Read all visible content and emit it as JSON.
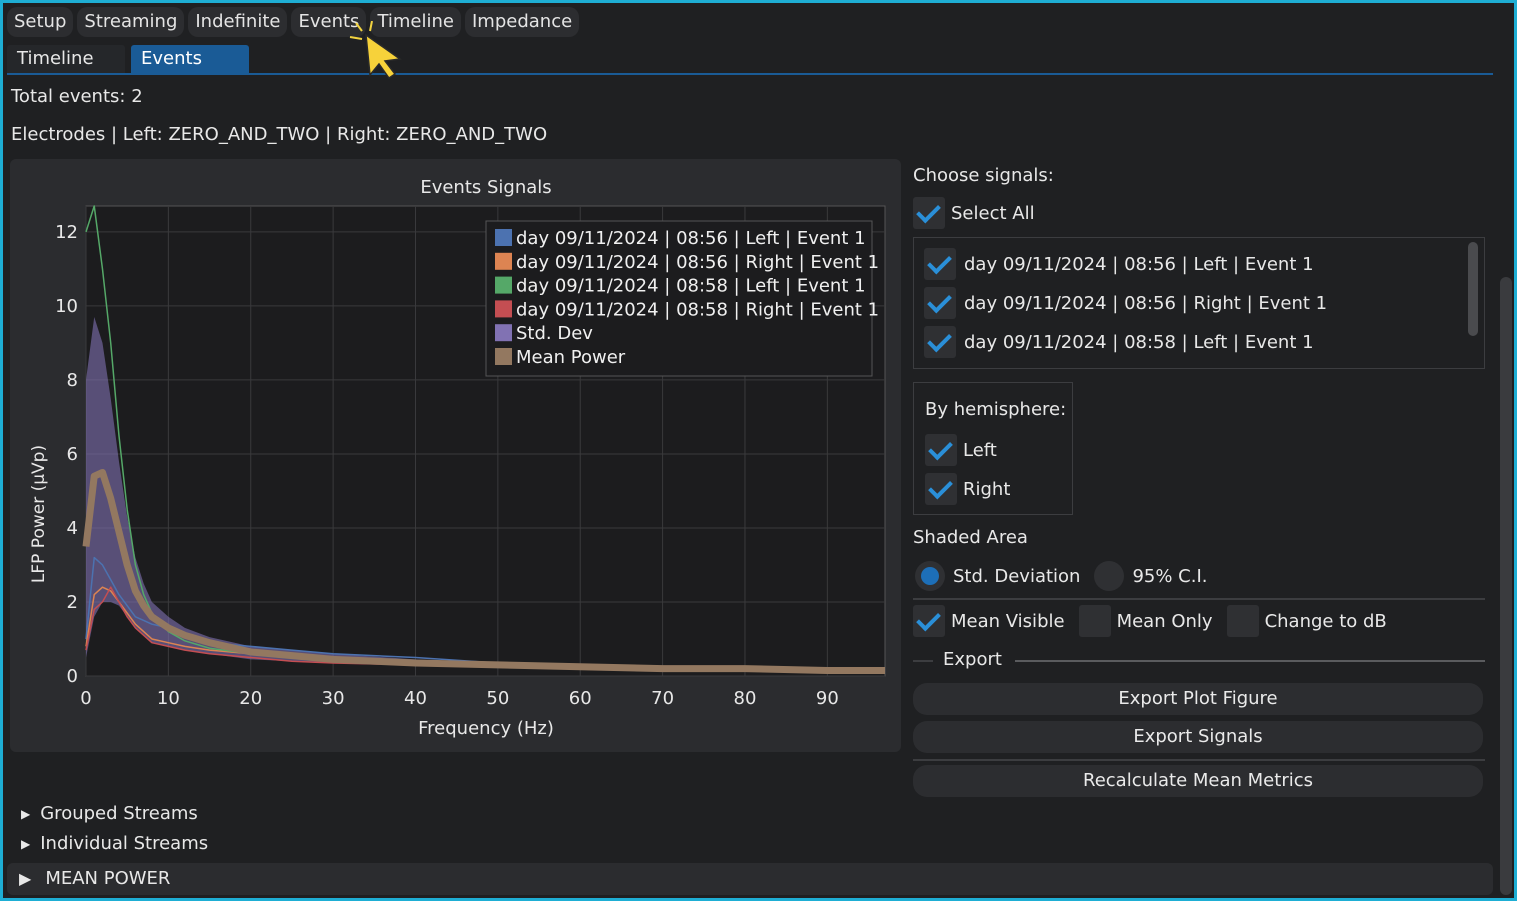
{
  "top_tabs": [
    "Setup",
    "Streaming",
    "Indefinite",
    "Events",
    "Timeline",
    "Impedance"
  ],
  "sub_tabs": [
    "Timeline",
    "Events"
  ],
  "active_sub_tab": "Events",
  "info": {
    "total_events": "Total events: 2",
    "electrodes": "Electrodes | Left: ZERO_AND_TWO | Right: ZERO_AND_TWO"
  },
  "chart_data": {
    "type": "line",
    "title": "Events Signals",
    "xlabel": "Frequency (Hz)",
    "ylabel": "LFP Power (µVp)",
    "xlim": [
      0,
      97
    ],
    "ylim": [
      0,
      12.7
    ],
    "xticks": [
      0,
      10,
      20,
      30,
      40,
      50,
      60,
      70,
      80,
      90
    ],
    "yticks": [
      0,
      2,
      4,
      6,
      8,
      10,
      12
    ],
    "grid": true,
    "legend_position": "top-right",
    "x": [
      0,
      1,
      2,
      3,
      4,
      5,
      6,
      7,
      8,
      10,
      12,
      15,
      20,
      25,
      30,
      40,
      50,
      60,
      70,
      80,
      90,
      97
    ],
    "series": [
      {
        "name": "day 09/11/2024 | 08:56 | Left | Event 1",
        "color": "#4c72b0",
        "values": [
          1.0,
          3.2,
          3.0,
          2.6,
          2.2,
          1.9,
          1.6,
          1.5,
          1.4,
          1.3,
          1.1,
          0.9,
          0.8,
          0.7,
          0.6,
          0.5,
          0.35,
          0.3,
          0.25,
          0.2,
          0.2,
          0.2
        ]
      },
      {
        "name": "day 09/11/2024 | 08:56 | Right | Event 1",
        "color": "#dd8452",
        "values": [
          0.8,
          2.2,
          2.4,
          2.3,
          2.0,
          1.7,
          1.4,
          1.2,
          1.0,
          0.9,
          0.8,
          0.7,
          0.6,
          0.5,
          0.45,
          0.35,
          0.3,
          0.25,
          0.2,
          0.2,
          0.15,
          0.15
        ]
      },
      {
        "name": "day 09/11/2024 | 08:58 | Left | Event 1",
        "color": "#55a868",
        "values": [
          12.0,
          12.7,
          11.0,
          9.0,
          6.5,
          4.5,
          3.0,
          2.2,
          1.7,
          1.2,
          0.95,
          0.75,
          0.6,
          0.5,
          0.45,
          0.35,
          0.3,
          0.25,
          0.2,
          0.2,
          0.15,
          0.15
        ]
      },
      {
        "name": "day 09/11/2024 | 08:58 | Right | Event 1",
        "color": "#c44e52",
        "values": [
          0.7,
          1.8,
          2.0,
          2.4,
          2.0,
          1.6,
          1.3,
          1.1,
          0.9,
          0.8,
          0.7,
          0.6,
          0.5,
          0.4,
          0.35,
          0.3,
          0.25,
          0.2,
          0.15,
          0.15,
          0.1,
          0.1
        ]
      },
      {
        "name": "Std. Dev",
        "color": "#8172b3",
        "kind": "band"
      },
      {
        "name": "Mean Power",
        "color": "#937860",
        "values": [
          3.5,
          5.4,
          5.5,
          4.8,
          3.9,
          3.0,
          2.3,
          1.9,
          1.6,
          1.3,
          1.1,
          0.9,
          0.65,
          0.55,
          0.45,
          0.35,
          0.3,
          0.25,
          0.2,
          0.2,
          0.15,
          0.15
        ]
      }
    ],
    "std_upper": [
      8.0,
      9.7,
      9.0,
      7.5,
      5.8,
      4.3,
      3.2,
      2.5,
      2.0,
      1.6,
      1.3,
      1.05,
      0.8,
      0.7,
      0.6,
      0.45,
      0.35,
      0.3,
      0.25,
      0.25,
      0.2,
      0.2
    ],
    "std_lower": [
      0.5,
      1.6,
      2.0,
      2.0,
      1.9,
      1.6,
      1.3,
      1.1,
      0.9,
      0.8,
      0.7,
      0.6,
      0.45,
      0.4,
      0.35,
      0.3,
      0.25,
      0.2,
      0.15,
      0.15,
      0.1,
      0.1
    ]
  },
  "right_panel": {
    "choose_signals": "Choose signals:",
    "select_all": "Select All",
    "signals": [
      "day 09/11/2024 | 08:56 | Left | Event 1",
      "day 09/11/2024 | 08:56 | Right | Event 1",
      "day 09/11/2024 | 08:58 | Left | Event 1"
    ],
    "by_hemisphere": "By hemisphere:",
    "hemi_left": "Left",
    "hemi_right": "Right",
    "shaded_area": "Shaded Area",
    "std_deviation": "Std. Deviation",
    "ci95": "95% C.I.",
    "mean_visible": "Mean Visible",
    "mean_only": "Mean Only",
    "change_db": "Change to dB",
    "export": "Export",
    "export_plot": "Export Plot Figure",
    "export_signals": "Export Signals",
    "recalc": "Recalculate Mean Metrics"
  },
  "bottom": {
    "grouped_streams": "Grouped Streams",
    "individual_streams": "Individual Streams",
    "mean_power": "MEAN POWER"
  }
}
